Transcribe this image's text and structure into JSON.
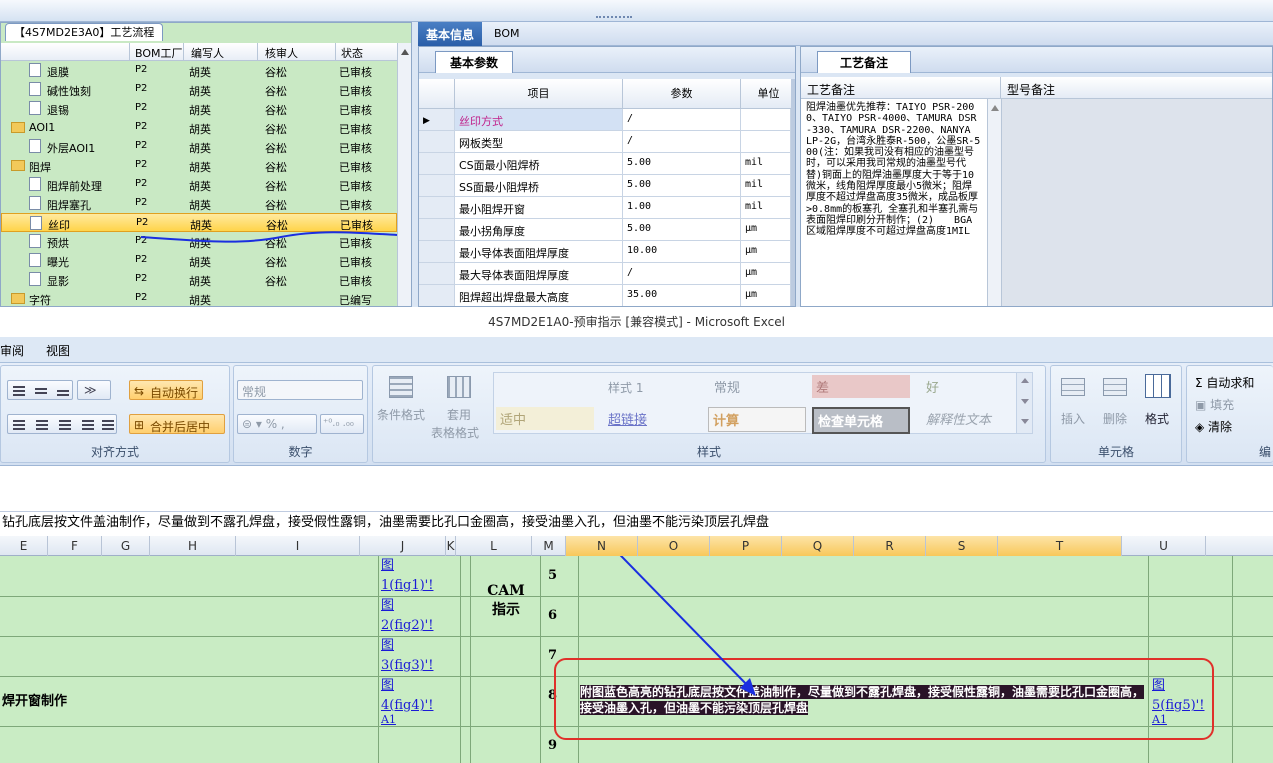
{
  "tree_panel": {
    "title": "【4S7MD2E3A0】工艺流程",
    "columns": [
      "BOM工厂",
      "编写人",
      "核审人",
      "状态"
    ],
    "rows": [
      {
        "name": "退膜",
        "factory": "P2",
        "author": "胡英",
        "reviewer": "谷松",
        "status": "已审核",
        "type": "doc",
        "level": 2
      },
      {
        "name": "碱性蚀刻",
        "factory": "P2",
        "author": "胡英",
        "reviewer": "谷松",
        "status": "已审核",
        "type": "doc",
        "level": 2
      },
      {
        "name": "退锡",
        "factory": "P2",
        "author": "胡英",
        "reviewer": "谷松",
        "status": "已审核",
        "type": "doc",
        "level": 2
      },
      {
        "name": "AOI1",
        "factory": "P2",
        "author": "胡英",
        "reviewer": "谷松",
        "status": "已审核",
        "type": "folder",
        "level": 1
      },
      {
        "name": "外层AOI1",
        "factory": "P2",
        "author": "胡英",
        "reviewer": "谷松",
        "status": "已审核",
        "type": "doc",
        "level": 2
      },
      {
        "name": "阻焊",
        "factory": "P2",
        "author": "胡英",
        "reviewer": "谷松",
        "status": "已审核",
        "type": "folder",
        "level": 1
      },
      {
        "name": "阻焊前处理",
        "factory": "P2",
        "author": "胡英",
        "reviewer": "谷松",
        "status": "已审核",
        "type": "doc",
        "level": 2
      },
      {
        "name": "阻焊塞孔",
        "factory": "P2",
        "author": "胡英",
        "reviewer": "谷松",
        "status": "已审核",
        "type": "doc",
        "level": 2
      },
      {
        "name": "丝印",
        "factory": "P2",
        "author": "胡英",
        "reviewer": "谷松",
        "status": "已审核",
        "type": "doc",
        "level": 2,
        "selected": true
      },
      {
        "name": "预烘",
        "factory": "P2",
        "author": "胡英",
        "reviewer": "谷松",
        "status": "已审核",
        "type": "doc",
        "level": 2
      },
      {
        "name": "曝光",
        "factory": "P2",
        "author": "胡英",
        "reviewer": "谷松",
        "status": "已审核",
        "type": "doc",
        "level": 2
      },
      {
        "name": "显影",
        "factory": "P2",
        "author": "胡英",
        "reviewer": "谷松",
        "status": "已审核",
        "type": "doc",
        "level": 2
      },
      {
        "name": "字符",
        "factory": "P2",
        "author": "胡英",
        "reviewer": "",
        "status": "已编写",
        "type": "folder",
        "level": 1
      }
    ]
  },
  "detail_tabs": [
    "基本信息",
    "BOM"
  ],
  "param_panel": {
    "tab": "基本参数",
    "columns": [
      "项目",
      "参数",
      "单位"
    ],
    "rows": [
      {
        "item": "丝印方式",
        "value": "/",
        "unit": "",
        "current": true
      },
      {
        "item": "网板类型",
        "value": "/",
        "unit": ""
      },
      {
        "item": "CS面最小阻焊桥",
        "value": "5.00",
        "unit": "mil"
      },
      {
        "item": "SS面最小阻焊桥",
        "value": "5.00",
        "unit": "mil"
      },
      {
        "item": "最小阻焊开窗",
        "value": "1.00",
        "unit": "mil"
      },
      {
        "item": "最小拐角厚度",
        "value": "5.00",
        "unit": "μm"
      },
      {
        "item": "最小导体表面阻焊厚度",
        "value": "10.00",
        "unit": "μm"
      },
      {
        "item": "最大导体表面阻焊厚度",
        "value": "/",
        "unit": "μm"
      },
      {
        "item": "阻焊超出焊盘最大高度",
        "value": "35.00",
        "unit": "μm"
      }
    ]
  },
  "remark_panel": {
    "tab": "工艺备注",
    "col1": "工艺备注",
    "col2": "型号备注",
    "text": "阻焊油墨优先推荐：TAIYO PSR-2000、TAIYO PSR-4000、TAMURA DSR-330、TAMURA DSR-2200、NANYA LP-2G，台湾永胜泰R-500，公墨SR-500(注：如果我司没有相应的油墨型号时，可以采用我司常规的油墨型号代替)铜面上的阻焊油墨厚度大于等于10微米，线角阻焊厚度最小5微米；阻焊厚度不超过焊盘高度35微米，成品板厚>0.8mm的板塞孔 全塞孔和半塞孔需与表面阻焊印刷分开制作；(2)　　BGA区域阻焊厚度不可超过焊盘高度1MIL"
  },
  "excel": {
    "title": "4S7MD2E1A0-预审指示 [兼容模式] - Microsoft Excel",
    "ribbon_tabs": [
      "审阅",
      "视图"
    ],
    "alignment": {
      "wrap": "自动换行",
      "merge": "合并后居中",
      "label": "对齐方式"
    },
    "number": {
      "format": "常规",
      "label": "数字"
    },
    "styles": {
      "cond_format": "条件格式",
      "table_format_1": "套用",
      "table_format_2": "表格格式",
      "cells": [
        "样式 1",
        "常规",
        "差",
        "好",
        "适中",
        "超链接",
        "计算",
        "检查单元格",
        "解释性文本"
      ],
      "label": "样式"
    },
    "cells_group": {
      "insert": "插入",
      "delete": "删除",
      "format": "格式",
      "label": "单元格"
    },
    "editing": {
      "autosum": "自动求和",
      "fill": "填充",
      "clear": "清除",
      "label": "编"
    },
    "formula_text": "钻孔底层按文件盖油制作，尽量做到不露孔焊盘，接受假性露铜，油墨需要比孔口金圈高，接受油墨入孔，但油墨不能污染顶层孔焊盘",
    "columns": [
      "E",
      "F",
      "G",
      "H",
      "I",
      "J",
      "K",
      "L",
      "M",
      "N",
      "O",
      "P",
      "Q",
      "R",
      "S",
      "T",
      "U"
    ],
    "row_numbers": [
      "5",
      "6",
      "7",
      "8",
      "9"
    ],
    "links": [
      "图\n1(fig1)'!",
      "图\n2(fig2)'!",
      "图\n3(fig3)'!",
      "图\n4(fig4)'!",
      "图\n5(fig5)'!"
    ],
    "link_tail": "A1",
    "cam_label": "CAM\n指示",
    "left_label": "焊开窗制作",
    "selected_cell_text": "附图蓝色高亮的钻孔底层按文件盖油制作，尽量做到不露孔焊盘，接受假性露铜，油墨需要比孔口金圈高，接受油墨入孔，但油墨不能污染顶层孔焊盘"
  },
  "colors": {
    "tree_bg": "#c9e9c4",
    "selection": "#ffd44a",
    "annotation_red": "#e0302a",
    "annotation_blue": "#1a2ee0",
    "cell_highlight": "#2a1428"
  }
}
